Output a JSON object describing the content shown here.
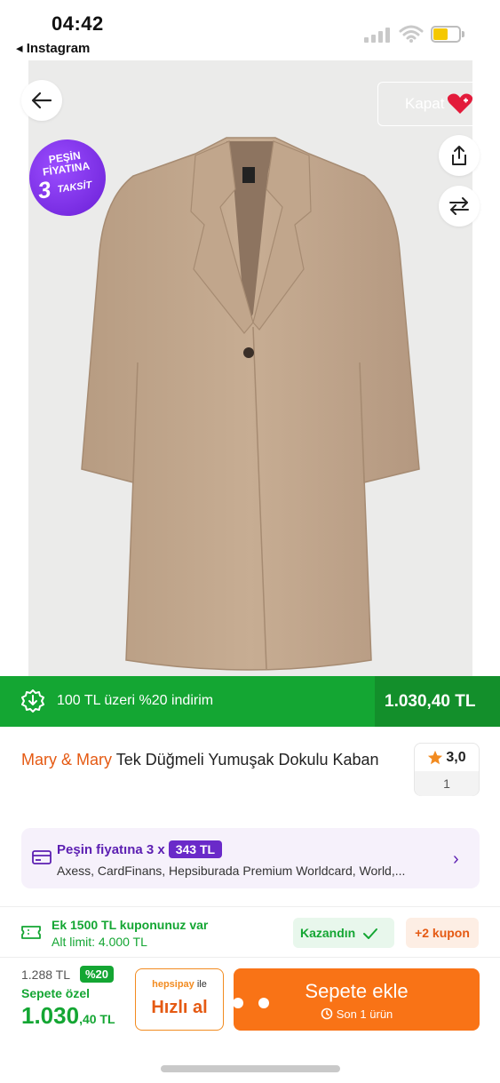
{
  "status_bar": {
    "time": "04:42",
    "back_app": "◂ Instagram"
  },
  "image_overlay": {
    "kapat_label": "Kapat",
    "promo": {
      "line1": "PEŞİN",
      "line2": "FİYATINA",
      "number": "3",
      "word": "TAKSİT"
    }
  },
  "discount": {
    "text": "100 TL üzeri %20 indirim",
    "price": "1.030,40 TL"
  },
  "product": {
    "brand": "Mary & Mary",
    "name": "Tek Düğmeli Yumuşak Dokulu Kaban"
  },
  "rating": {
    "score": "3,0",
    "count": "1"
  },
  "installment": {
    "prefix": "Peşin fiyatına 3 x",
    "amount": "343 TL",
    "cards": "Axess, CardFinans, Hepsiburada Premium Worldcard, World,..."
  },
  "coupon": {
    "line1": "Ek 1500 TL kuponunuz var",
    "line2": "Alt limit: 4.000 TL",
    "won_label": "Kazandın",
    "more_label": "+2 kupon"
  },
  "pricing": {
    "old_price": "1.288 TL",
    "discount_pct": "%20",
    "special_label": "Sepete özel",
    "price_main": "1.030",
    "price_decimal": ",40 TL"
  },
  "buttons": {
    "hizli_brand": "hepsipay",
    "hizli_brand_suffix": "ile",
    "hizli_label": "Hızlı al",
    "add_to_cart": "Sepete ekle",
    "stock_note": "Son 1 ürün"
  },
  "colors": {
    "brand_orange": "#f97316",
    "discount_green": "#14a633",
    "installment_purple": "#6a2ac9"
  }
}
